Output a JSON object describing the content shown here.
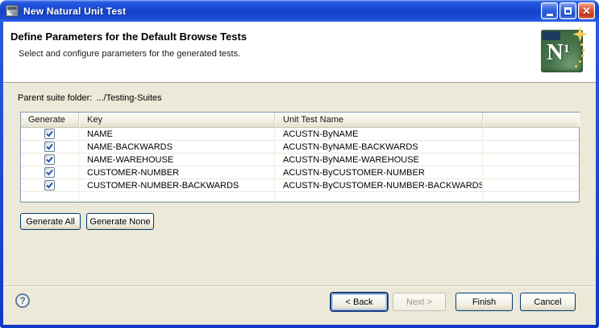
{
  "window": {
    "title": "New Natural Unit Test"
  },
  "header": {
    "title": "Define Parameters for the Default Browse Tests",
    "subtitle": "Select and configure parameters for the generated tests.",
    "logo": {
      "letter": "N",
      "superscript": "1"
    }
  },
  "content": {
    "parent_suite_label": "Parent suite folder:",
    "parent_suite_value": ".../Testing-Suites"
  },
  "table": {
    "columns": {
      "generate": "Generate",
      "key": "Key",
      "unit_test_name": "Unit Test Name"
    },
    "rows": [
      {
        "checked": true,
        "key": "NAME",
        "unit_test_name": "ACUSTN-ByNAME"
      },
      {
        "checked": true,
        "key": "NAME-BACKWARDS",
        "unit_test_name": "ACUSTN-ByNAME-BACKWARDS"
      },
      {
        "checked": true,
        "key": "NAME-WAREHOUSE",
        "unit_test_name": "ACUSTN-ByNAME-WAREHOUSE"
      },
      {
        "checked": true,
        "key": "CUSTOMER-NUMBER",
        "unit_test_name": "ACUSTN-ByCUSTOMER-NUMBER"
      },
      {
        "checked": true,
        "key": "CUSTOMER-NUMBER-BACKWARDS",
        "unit_test_name": "ACUSTN-ByCUSTOMER-NUMBER-BACKWARDS"
      }
    ]
  },
  "buttons": {
    "generate_all": "Generate All",
    "generate_none": "Generate None",
    "back": "< Back",
    "next": "Next >",
    "next_enabled": false,
    "finish": "Finish",
    "cancel": "Cancel"
  },
  "footer": {
    "help_glyph": "?"
  },
  "colors": {
    "titlebar_blue": "#1442ca",
    "window_border": "#0f3bc6",
    "dialog_background": "#ece9d8",
    "header_background": "#ffffff",
    "table_border": "#839cb5",
    "check_blue": "#2353b0",
    "close_red": "#d8502e",
    "button_border": "#003c74",
    "disabled_text": "#9c998a",
    "logo_green": "#47744b",
    "logo_navy": "#1d3a60",
    "logo_gold": "#f5cf5c"
  }
}
